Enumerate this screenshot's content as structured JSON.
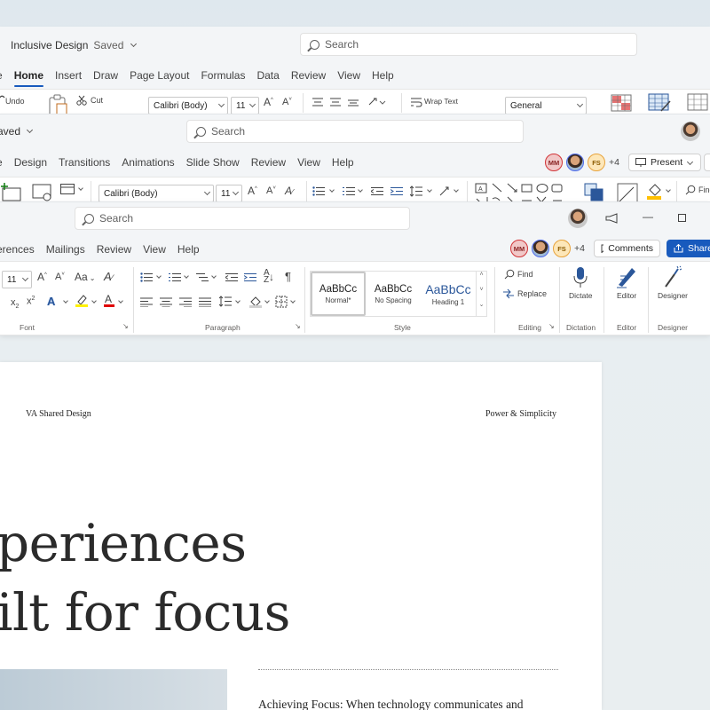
{
  "window1": {
    "doc_title": "Inclusive Design",
    "saved": "Saved",
    "search_placeholder": "Search",
    "tabs": [
      "Home",
      "Insert",
      "Draw",
      "Page Layout",
      "Formulas",
      "Data",
      "Review",
      "View",
      "Help"
    ],
    "active_tab": "Home",
    "ribbon": {
      "undo": "Undo",
      "cut": "Cut",
      "font": "Calibri (Body)",
      "size": "11",
      "wrap_text": "Wrap Text",
      "number_format": "General"
    }
  },
  "window2": {
    "saved": "aved",
    "search_placeholder": "Search",
    "tabs": [
      "Design",
      "Transitions",
      "Animations",
      "Slide Show",
      "Review",
      "View",
      "Help"
    ],
    "collaborators": [
      "MM",
      "FS"
    ],
    "extra_count": "+4",
    "present_label": "Present",
    "ribbon": {
      "font": "Calibri (Body)",
      "size": "11",
      "find": "Find"
    }
  },
  "window3": {
    "search_placeholder": "Search",
    "tabs": [
      "erences",
      "Mailings",
      "Review",
      "View",
      "Help"
    ],
    "collaborators": [
      "MM",
      "FS"
    ],
    "extra_count": "+4",
    "comments_label": "Comments",
    "share_label": "Share",
    "ribbon": {
      "size": "11",
      "font_aa": "Aa",
      "groups": [
        "Font",
        "Paragraph",
        "Style",
        "Editing",
        "Dictation",
        "Editor",
        "Designer"
      ],
      "styles": [
        {
          "sample": "AaBbCc",
          "name": "Normal*"
        },
        {
          "sample": "AaBbCc",
          "name": "No Spacing"
        },
        {
          "sample": "AaBbCc",
          "name": "Heading 1"
        }
      ],
      "find": "Find",
      "replace": "Replace",
      "dictate": "Dictate",
      "editor": "Editor",
      "designer": "Designer"
    }
  },
  "document": {
    "header_left": "VA Shared Design",
    "header_right": "Power & Simplicity",
    "title_line1": "periences",
    "title_line2": "ilt for focus",
    "subheading": "Achieving Focus: When technology communicates and"
  },
  "colors": {
    "accent": "#185abd",
    "avatar_mm": "#d13438",
    "avatar_fs": "#e8a33b"
  }
}
